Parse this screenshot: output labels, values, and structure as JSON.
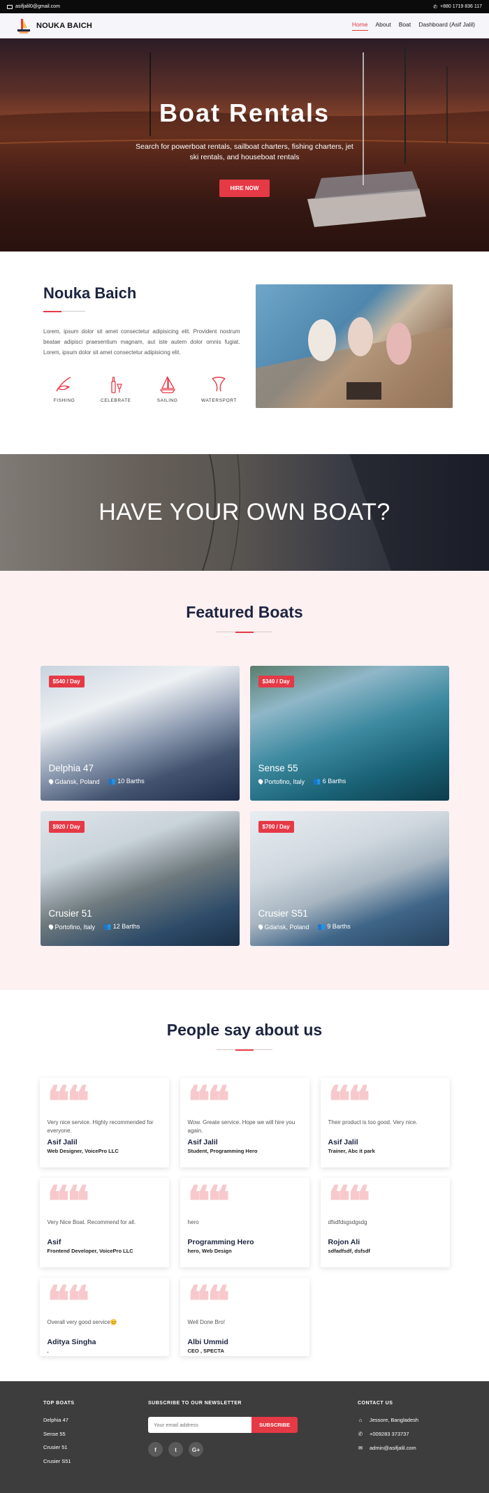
{
  "topbar": {
    "email": "asifjalil0@gmail.com",
    "phone": "+880 1719 836 117"
  },
  "nav": {
    "brand": "NOUKA BAICH",
    "links": [
      {
        "label": "Home",
        "active": true
      },
      {
        "label": "About"
      },
      {
        "label": "Boat"
      },
      {
        "label": "Dashboard (Asif Jalil)"
      }
    ]
  },
  "hero": {
    "title": "Boat Rentals",
    "subtitle": "Search for powerboat rentals, sailboat charters, fishing charters, jet ski rentals, and houseboat rentals",
    "button": "HIRE NOW"
  },
  "about": {
    "title": "Nouka Baich",
    "text": "Lorem, ipsum dolor sit amet consectetur adipisicing elit. Provident nostrum beatae adipisci praesentium magnam, aut iste autem dolor omnis fugiat. Lorem, ipsum dolor sit amet consectetur adipisicing elit.",
    "services": [
      {
        "label": "FISHING",
        "icon": "fishing-icon"
      },
      {
        "label": "CELEBRATE",
        "icon": "celebrate-icon"
      },
      {
        "label": "SAILING",
        "icon": "sailing-icon"
      },
      {
        "label": "WATERSPORT",
        "icon": "watersport-icon"
      }
    ]
  },
  "band": {
    "title": "HAVE YOUR OWN BOAT?"
  },
  "featured": {
    "title": "Featured Boats",
    "boats": [
      {
        "price": "$540 / Day",
        "name": "Delphia 47",
        "location": "Gdańsk, Poland",
        "berths": "10 Barths"
      },
      {
        "price": "$340 / Day",
        "name": "Sense 55",
        "location": "Portofino, Italy",
        "berths": "6 Barths"
      },
      {
        "price": "$920 / Day",
        "name": "Crusier 51",
        "location": "Portofino, Italy",
        "berths": "12 Barths"
      },
      {
        "price": "$700 / Day",
        "name": "Crusier S51",
        "location": "Gdańsk, Poland",
        "berths": "9 Barths"
      }
    ]
  },
  "testimonials": {
    "title": "People say about us",
    "items": [
      {
        "text": "Very nice service. Highly recommended for everyone.",
        "name": "Asif Jalil",
        "role": "Web Designer, VoicePro LLC"
      },
      {
        "text": "Wow. Greate service. Hope we will hire you again.",
        "name": "Asif Jalil",
        "role": "Student, Programming Hero"
      },
      {
        "text": "Their product is too good. Very nice.",
        "name": "Asif Jalil",
        "role": "Trainer, Abc it park"
      },
      {
        "text": "Very Nice Boat. Recommend for all.",
        "name": "Asif",
        "role": "Frontend Developer, VoicePro LLC"
      },
      {
        "text": "hero",
        "name": "Programming Hero",
        "role": "hero, Web Design"
      },
      {
        "text": "dfsdfdsgsdgsdg",
        "name": "Rojon Ali",
        "role": "sdfadfsdf, dsfsdf"
      },
      {
        "text": "Overall very good service😊",
        "name": "Aditya Singha",
        "role": "."
      },
      {
        "text": "Well Done Bro!",
        "name": "Albi Ummid",
        "role": "CEO , SPECTA"
      }
    ]
  },
  "footer": {
    "top_boats_title": "TOP BOATS",
    "top_boats": [
      "Delphia 47",
      "Sense 55",
      "Crusier 51",
      "Crusier S51"
    ],
    "newsletter_title": "SUBSCRIBE TO OUR NEWSLETTER",
    "newsletter_placeholder": "Your email address",
    "subscribe": "SUBSCRIBE",
    "socials": [
      "f",
      "t",
      "G+"
    ],
    "contact_title": "CONTACT US",
    "contact": [
      {
        "icon": "home-icon",
        "glyph": "⌂",
        "text": "Jessore, Bangladesh"
      },
      {
        "icon": "phone-icon",
        "glyph": "✆",
        "text": "+009283 373737"
      },
      {
        "icon": "mail-icon",
        "glyph": "✉",
        "text": "admin@asifjalil.com"
      }
    ]
  },
  "colors": {
    "accent": "#e63946",
    "navy": "#1d2440",
    "footer_bg": "#3d3d3d",
    "featured_bg": "#fdf1f2"
  }
}
